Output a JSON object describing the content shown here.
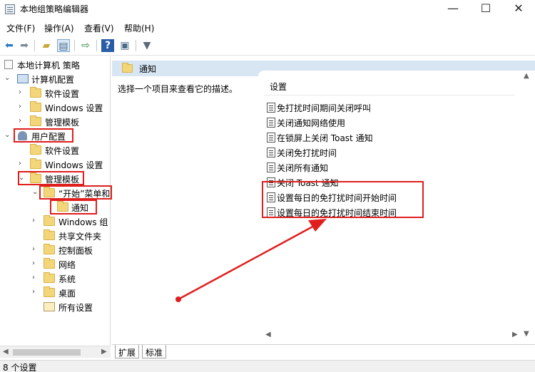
{
  "window": {
    "title": "本地组策略编辑器",
    "minimize": "—",
    "maximize": "☐",
    "close": "✕"
  },
  "menu": [
    "文件(F)",
    "操作(A)",
    "查看(V)",
    "帮助(H)"
  ],
  "toolbar_icons": [
    "back-arrow-icon",
    "forward-arrow-icon",
    "folder-up-icon",
    "show-hide-tree-icon",
    "export-list-icon",
    "help-icon",
    "properties-icon",
    "filter-icon"
  ],
  "tree": {
    "root": "本地计算机 策略",
    "computer_config": "计算机配置",
    "computer_software": "软件设置",
    "computer_windows": "Windows 设置",
    "computer_admin": "管理模板",
    "user_config": "用户配置",
    "user_software": "软件设置",
    "user_windows": "Windows 设置",
    "user_admin": "管理模板",
    "start_menu": "“开始”菜单和",
    "notifications": "通知",
    "windows_components": "Windows 组",
    "shared_folders": "共享文件夹",
    "control_panel": "控制面板",
    "network": "网络",
    "system": "系统",
    "desktop": "桌面",
    "all_settings": "所有设置"
  },
  "right": {
    "header_title": "通知",
    "description": "选择一个项目来查看它的描述。",
    "column_header": "设置",
    "items": [
      "免打扰时间期间关闭呼叫",
      "关闭通知网络使用",
      "在锁屏上关闭 Toast 通知",
      "关闭免打扰时间",
      "关闭所有通知",
      "关闭 Toast 通知",
      "设置每日的免打扰时间开始时间",
      "设置每日的免打扰时间结束时间"
    ]
  },
  "tabs": [
    "扩展",
    "标准"
  ],
  "status": "8 个设置",
  "colors": {
    "highlight": "#e01e1e",
    "header_bg": "#d8e6f4",
    "folder": "#f3d57a"
  }
}
